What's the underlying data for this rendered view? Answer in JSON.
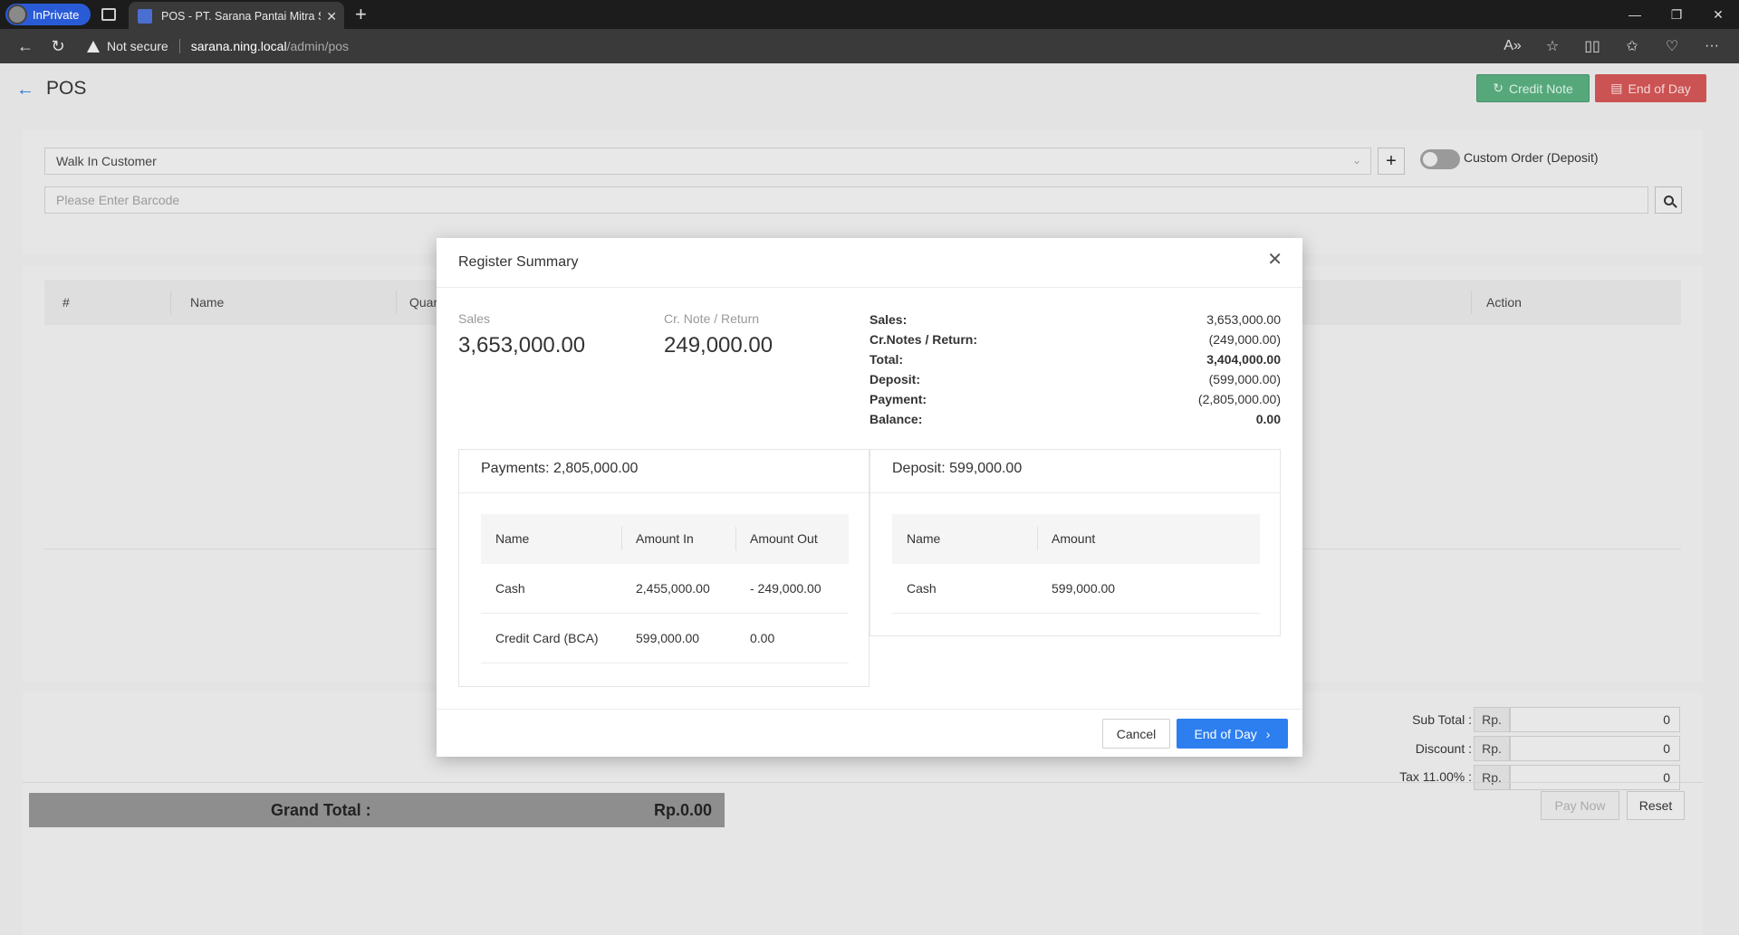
{
  "browser": {
    "profile_label": "InPrivate",
    "tab_title": "POS - PT. Sarana Pantai Mitra Se",
    "security_label": "Not secure",
    "url_host": "sarana.ning.local",
    "url_path": "/admin/pos"
  },
  "page": {
    "title": "POS",
    "credit_note_label": "Credit Note",
    "end_of_day_label": "End of Day",
    "customer_value": "Walk In Customer",
    "toggle_label": "Custom Order (Deposit)",
    "barcode_placeholder": "Please Enter Barcode",
    "table_headers": {
      "num": "#",
      "name": "Name",
      "qty": "Quar",
      "action": "Action"
    },
    "summary": {
      "subtotal_label": "Sub Total :",
      "discount_label": "Discount :",
      "tax_label": "Tax 11.00% :",
      "currency": "Rp.",
      "subtotal_value": "0",
      "discount_value": "0",
      "tax_value": "0",
      "grand_total_label": "Grand Total :",
      "grand_total_value": "Rp.0.00",
      "pay_now_label": "Pay Now",
      "reset_label": "Reset"
    }
  },
  "modal": {
    "title": "Register Summary",
    "sales_label": "Sales",
    "sales_value": "3,653,000.00",
    "credit_label": "Cr. Note / Return",
    "credit_value": "249,000.00",
    "summary_rows": [
      {
        "k": "Sales:",
        "v": "3,653,000.00"
      },
      {
        "k": "Cr.Notes / Return:",
        "v": "(249,000.00)"
      },
      {
        "k": "Total:",
        "v": "3,404,000.00"
      },
      {
        "k": "Deposit:",
        "v": "(599,000.00)"
      },
      {
        "k": "Payment:",
        "v": "(2,805,000.00)"
      },
      {
        "k": "Balance:",
        "v": "0.00"
      }
    ],
    "payments": {
      "title": "Payments: 2,805,000.00",
      "headers": {
        "name": "Name",
        "in": "Amount In",
        "out": "Amount Out"
      },
      "rows": [
        {
          "name": "Cash",
          "in": "2,455,000.00",
          "out": "- 249,000.00"
        },
        {
          "name": "Credit Card (BCA)",
          "in": "599,000.00",
          "out": "0.00"
        }
      ]
    },
    "deposit": {
      "title": "Deposit: 599,000.00",
      "headers": {
        "name": "Name",
        "amount": "Amount"
      },
      "rows": [
        {
          "name": "Cash",
          "amount": "599,000.00"
        }
      ]
    },
    "cancel_label": "Cancel",
    "end_of_day_label": "End of Day"
  }
}
